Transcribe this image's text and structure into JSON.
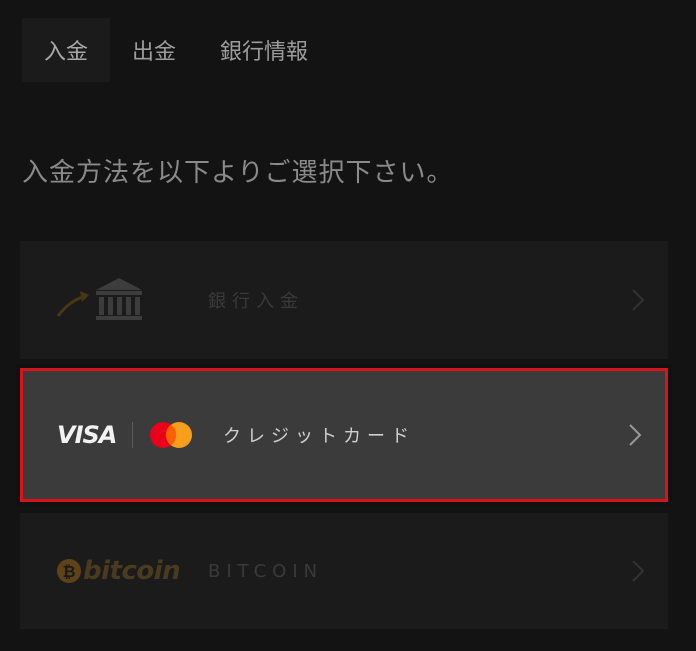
{
  "tabs": [
    {
      "label": "入金",
      "active": true
    },
    {
      "label": "出金",
      "active": false
    },
    {
      "label": "銀行情報",
      "active": false
    }
  ],
  "instruction": "入金方法を以下よりご選択下さい。",
  "methods": [
    {
      "label": "銀行入金",
      "icon": "bank-icon",
      "selected": false
    },
    {
      "label": "クレジットカード",
      "logo_text": "VISA",
      "icon": "mastercard-logo",
      "selected": true
    },
    {
      "label": "BITCOIN",
      "logo_text": "bitcoin",
      "icon": "bitcoin-icon",
      "selected": false
    }
  ],
  "colors": {
    "background": "#131313",
    "selected_border": "#d9131b",
    "mastercard_red": "#eb001b",
    "mastercard_orange": "#f79e1b",
    "bitcoin_orange": "#7a5520"
  }
}
